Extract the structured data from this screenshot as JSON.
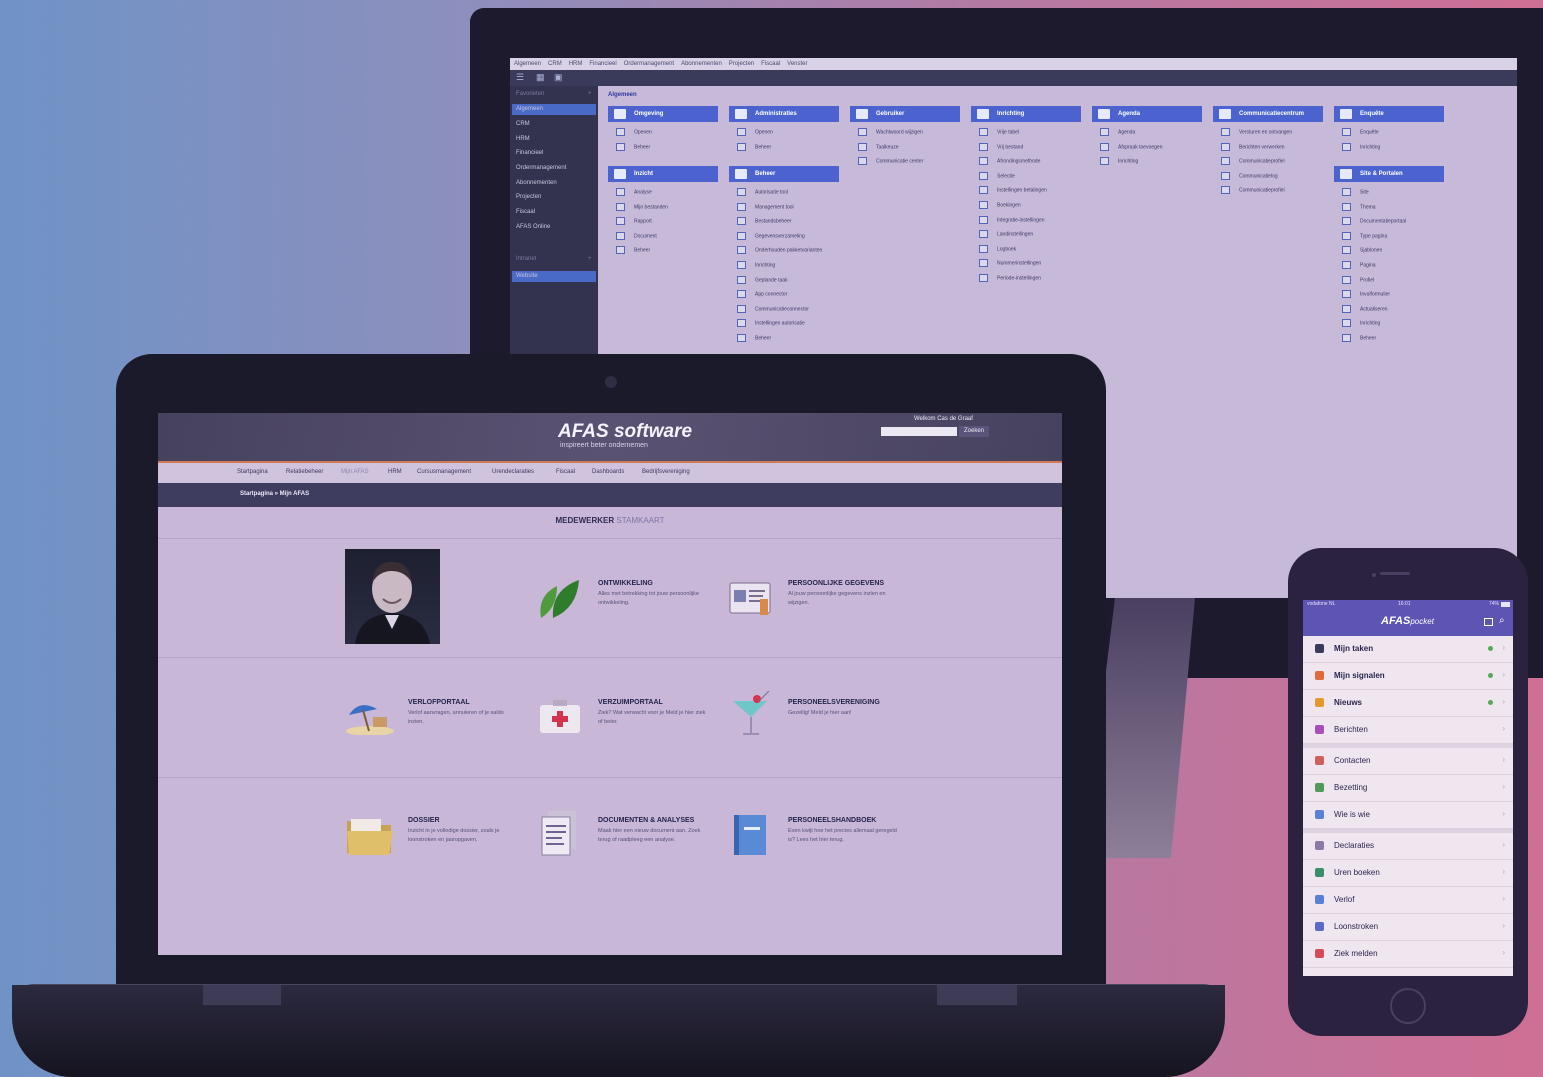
{
  "colors": {
    "accent": "#4c63cf",
    "phone_header": "#5e54b3",
    "laptop_header": "#46425e",
    "orange_line": "#d17a55",
    "status_green": "#56a85a"
  },
  "monitor": {
    "menu": [
      "Algemeen",
      "CRM",
      "HRM",
      "Financieel",
      "Ordermanagement",
      "Abonnementen",
      "Projecten",
      "Fiscaal",
      "Venster"
    ],
    "toolbar_icons": [
      "menu-icon",
      "grid-icon",
      "image-icon"
    ],
    "sidebar": {
      "header": "Favorieten",
      "add_icon": "+",
      "items": [
        "Algemeen",
        "CRM",
        "HRM",
        "Financieel",
        "Ordermanagement",
        "Abonnementen",
        "Projecten",
        "Fiscaal",
        "AFAS Online"
      ],
      "header2": "Intranet",
      "add2": "+",
      "items2": [
        "Website"
      ]
    },
    "title": "Algemeen",
    "tiles": [
      {
        "label": "Omgeving",
        "rows": [
          "Openen",
          "Beheer"
        ]
      },
      {
        "label": "Administraties",
        "rows": [
          "Openen",
          "Beheer"
        ]
      },
      {
        "label": "Gebruiker",
        "rows": [
          "Wachtwoord wijzigen",
          "Taalkeuze",
          "Communicatie center"
        ]
      },
      {
        "label": "Inrichting",
        "rows": [
          "Vrije tabel",
          "Vrij bestand",
          "Afrondingsmethode",
          "Selectie",
          "Instellingen betalingen",
          "Boekingen",
          "Integratie-instellingen",
          "Landinstellingen",
          "Logboek",
          "Nummerinstellingen",
          "Periode-instellingen"
        ]
      },
      {
        "label": "Agenda",
        "rows": [
          "Agenda",
          "Afspraak toevoegen",
          "Inrichting"
        ]
      },
      {
        "label": "Communicatiecentrum",
        "rows": [
          "Versturen en ontvangen",
          "Berichten verwerken",
          "Communicatieprofiel",
          "Communicatielog",
          "Communicatieprofiel"
        ]
      },
      {
        "label": "Enquête",
        "rows": [
          "Enquête",
          "Inrichting"
        ]
      },
      {
        "label": "Inzicht",
        "rows": [
          "Analyse",
          "Mijn bestanden",
          "Rapport",
          "Document",
          "Beheer"
        ]
      },
      {
        "label": "Beheer",
        "rows": [
          "Autorisatie tool",
          "Management tool",
          "Bestandsbeheer",
          "Gegevensverzameling",
          "Onderhouden pakketvarianten",
          "Inrichting",
          "Geplande taak",
          "App connector",
          "Communicatieconnector",
          "Instellingen autorisatie",
          "Beheer"
        ]
      },
      {
        "label": "Site & Portalen",
        "rows": [
          "Site",
          "Thema",
          "Documentatieportaal",
          "Type pagina",
          "Sjablonen",
          "Pagina",
          "Profiel",
          "Invulformulier",
          "Actualiseren",
          "Inrichting",
          "Beheer"
        ]
      }
    ]
  },
  "laptop": {
    "logo": "AFAS software",
    "tagline": "inspireert beter ondernemen",
    "welcome": "Welkom Cas de Graaf",
    "search_placeholder": "",
    "search_button": "Zoeken",
    "nav": [
      "Startpagina",
      "Relatiebeheer",
      "Mijn AFAS",
      "HRM",
      "Cursusmanagement",
      "Urendeclaraties",
      "Fiscaal",
      "Dashboards",
      "Bedrijfsvereniging"
    ],
    "breadcrumb": "Startpagina » Mijn AFAS",
    "title_bold": "MEDEWERKER",
    "title_light": "STAMKAART",
    "cards": [
      {
        "title": "ONTWIKKELING",
        "desc": "Alles met betrekking tot jouw persoonlijke ontwikkeling.",
        "icon": "leaf-icon"
      },
      {
        "title": "PERSOONLIJKE GEGEVENS",
        "desc": "Al jouw persoonlijke gegevens inzien en wijzigen.",
        "icon": "id-card-icon"
      },
      {
        "title": "VERLOFPORTAAL",
        "desc": "Verlof aanvragen, annuleren of je saldo inzien.",
        "icon": "beach-icon"
      },
      {
        "title": "VERZUIMPORTAAL",
        "desc": "Ziek? Wat verwacht voor je Meld je hier ziek of beter.",
        "icon": "first-aid-icon"
      },
      {
        "title": "PERSONEELSVERENIGING",
        "desc": "Gezellig! Meld je hier aan!",
        "icon": "cocktail-icon"
      },
      {
        "title": "DOSSIER",
        "desc": "Inzicht in je volledige dossier, zoals je loonstroken en jaaropgaven.",
        "icon": "folder-icon"
      },
      {
        "title": "DOCUMENTEN & ANALYSES",
        "desc": "Maak hier een nieuw document aan. Zoek terug of raadpleeg een analyse.",
        "icon": "document-icon"
      },
      {
        "title": "PERSONEELSHANDBOEK",
        "desc": "Even kwijt hoe het precies allemaal geregeld is? Lees het hier terug.",
        "icon": "book-icon"
      }
    ]
  },
  "phone": {
    "status_left": "vodafone NL",
    "status_time": "16:01",
    "status_right": "74%",
    "logo": "AFAS",
    "logo_suffix": "pocket",
    "header_icons": [
      "calendar-icon",
      "search-icon"
    ],
    "groups": [
      [
        {
          "label": "Mijn taken",
          "icon_color": "#3a3a5a",
          "bold": true,
          "dot": true
        },
        {
          "label": "Mijn signalen",
          "icon_color": "#e06a3b",
          "bold": true,
          "dot": true
        },
        {
          "label": "Nieuws",
          "icon_color": "#e29a2e",
          "bold": true,
          "dot": true
        },
        {
          "label": "Berichten",
          "icon_color": "#a84fb6",
          "bold": false,
          "dot": false
        }
      ],
      [
        {
          "label": "Contacten",
          "icon_color": "#d06060",
          "bold": false,
          "dot": false
        },
        {
          "label": "Bezetting",
          "icon_color": "#4e9a5a",
          "bold": false,
          "dot": false
        },
        {
          "label": "Wie is wie",
          "icon_color": "#5a7fd6",
          "bold": false,
          "dot": false
        }
      ],
      [
        {
          "label": "Declaraties",
          "icon_color": "#8a7aa8",
          "bold": false,
          "dot": false
        },
        {
          "label": "Uren boeken",
          "icon_color": "#3a8f6a",
          "bold": false,
          "dot": false
        },
        {
          "label": "Verlof",
          "icon_color": "#5a7fd6",
          "bold": false,
          "dot": false
        },
        {
          "label": "Loonstroken",
          "icon_color": "#5a6ac7",
          "bold": false,
          "dot": false
        },
        {
          "label": "Ziek melden",
          "icon_color": "#d64a5a",
          "bold": false,
          "dot": false
        }
      ]
    ]
  }
}
